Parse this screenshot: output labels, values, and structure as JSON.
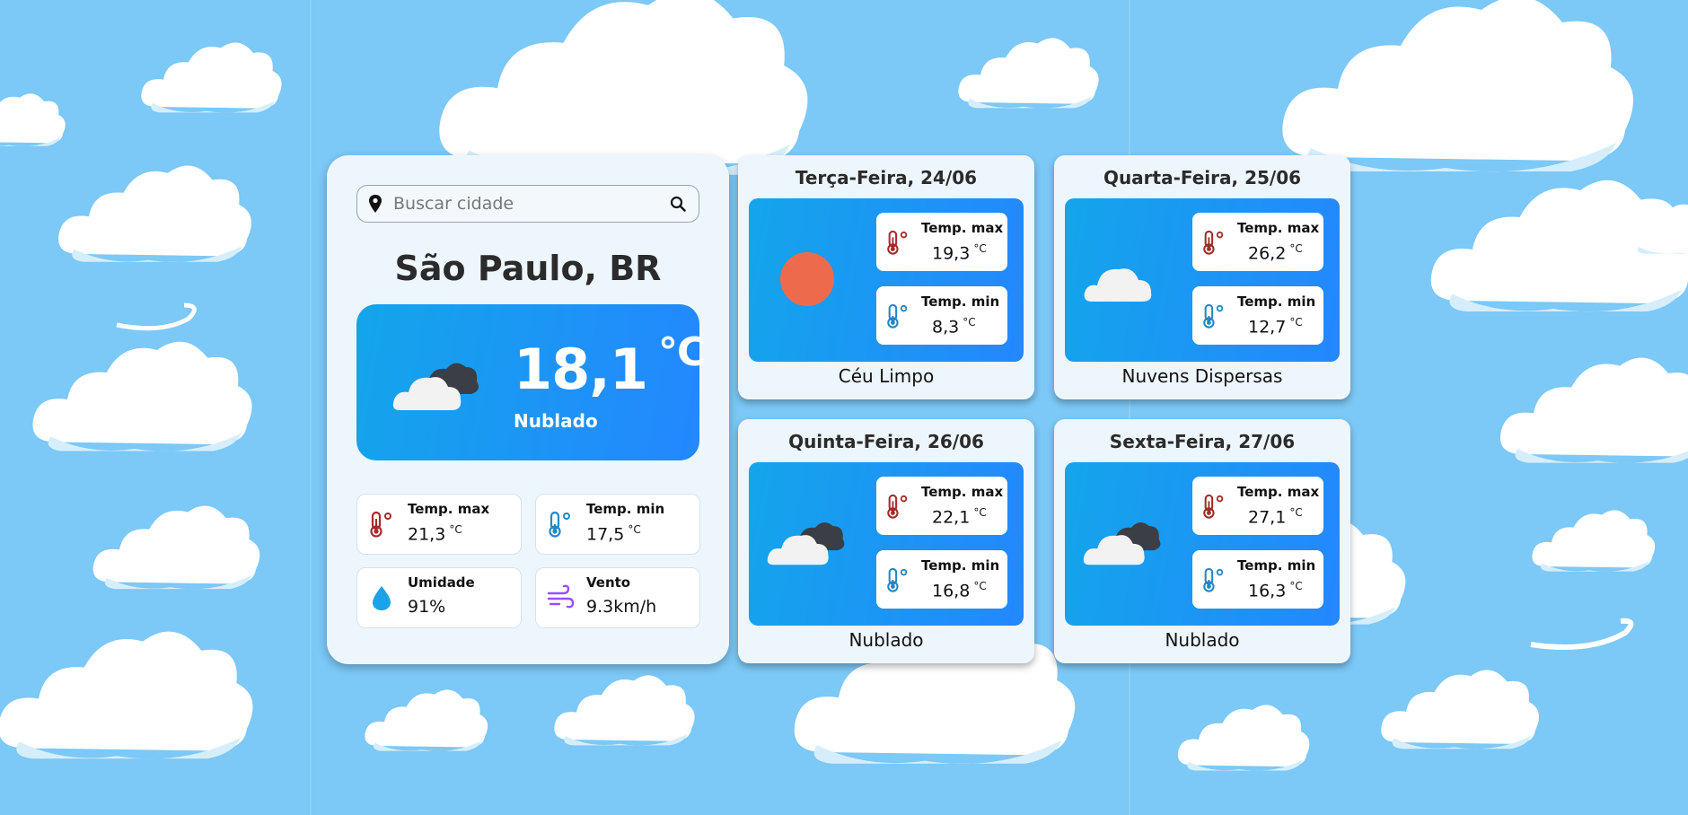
{
  "search": {
    "placeholder": "Buscar cidade",
    "value": ""
  },
  "current": {
    "city": "São Paulo, BR",
    "temp": "18,1",
    "unit": "°C",
    "description": "Nublado",
    "icon": "cloudy-icon",
    "stats": [
      {
        "label": "Temp. max",
        "value": "21,3",
        "unit": "°C",
        "icon": "thermometer-hot-icon"
      },
      {
        "label": "Temp. min",
        "value": "17,5",
        "unit": "°C",
        "icon": "thermometer-cold-icon"
      },
      {
        "label": "Umidade",
        "value": "91%",
        "icon": "water-drop-icon"
      },
      {
        "label": "Vento",
        "value": "9.3km/h",
        "icon": "wind-icon"
      }
    ]
  },
  "forecast": [
    {
      "day": "Terça-Feira, 24/06",
      "max_label": "Temp. max",
      "max": "19,3",
      "min_label": "Temp. min",
      "min": "8,3",
      "unit": "°C",
      "condition": "Céu Limpo",
      "icon": "sun-icon"
    },
    {
      "day": "Quarta-Feira, 25/06",
      "max_label": "Temp. max",
      "max": "26,2",
      "min_label": "Temp. min",
      "min": "12,7",
      "unit": "°C",
      "condition": "Nuvens Dispersas",
      "icon": "cloud-icon"
    },
    {
      "day": "Quinta-Feira, 26/06",
      "max_label": "Temp. max",
      "max": "22,1",
      "min_label": "Temp. min",
      "min": "16,8",
      "unit": "°C",
      "condition": "Nublado",
      "icon": "cloudy-icon"
    },
    {
      "day": "Sexta-Feira, 27/06",
      "max_label": "Temp. max",
      "max": "27,1",
      "min_label": "Temp. min",
      "min": "16,3",
      "unit": "°C",
      "condition": "Nublado",
      "icon": "cloudy-icon"
    }
  ],
  "colors": {
    "sky": "#7cc8f6",
    "card": "#eef6fd",
    "panel_start": "#13a5ea",
    "panel_end": "#2487ff",
    "sun": "#ed6b4c",
    "hot": "#a52a2a",
    "cold": "#1e88c8",
    "drop": "#1aa3e8",
    "wind": "#9b4dff"
  }
}
